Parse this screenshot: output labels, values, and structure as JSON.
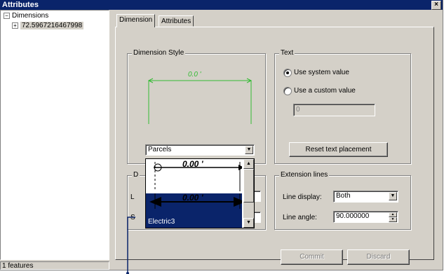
{
  "window": {
    "title": "Attributes",
    "close_glyph": "×"
  },
  "tree": {
    "root": {
      "expander": "−",
      "label": "Dimensions"
    },
    "child": {
      "expander": "+",
      "label": "72.5967216467998"
    }
  },
  "status": {
    "text": "1 features"
  },
  "tabs": [
    {
      "label": "Dimension",
      "active": true
    },
    {
      "label": "Attributes",
      "active": false
    }
  ],
  "dimension_style": {
    "label": "Dimension Style",
    "preview_text": "0.0 '",
    "preview_color": "#33bb33",
    "selected_style": "Parcels"
  },
  "style_list": {
    "items": [
      {
        "label": "",
        "sample_text": "0.00 '"
      },
      {
        "label": "Electric3",
        "sample_text": "0.00 '",
        "highlighted": true
      }
    ],
    "highlight_color": "#0a246a"
  },
  "text_group": {
    "label": "Text",
    "options": [
      {
        "label": "Use system value",
        "checked": true
      },
      {
        "label": "Use a custom value",
        "checked": false
      }
    ],
    "custom_value": "0",
    "reset_button": "Reset text placement"
  },
  "hidden_group": {
    "label_fragment": "D",
    "row1_fragment": "L",
    "row2_fragment": "S"
  },
  "extension_lines": {
    "label": "Extension lines",
    "line_display_label": "Line display:",
    "line_display_value": "Both",
    "line_angle_label": "Line angle:",
    "line_angle_value": "90.000000"
  },
  "buttons": {
    "commit": "Commit",
    "discard": "Discard"
  }
}
